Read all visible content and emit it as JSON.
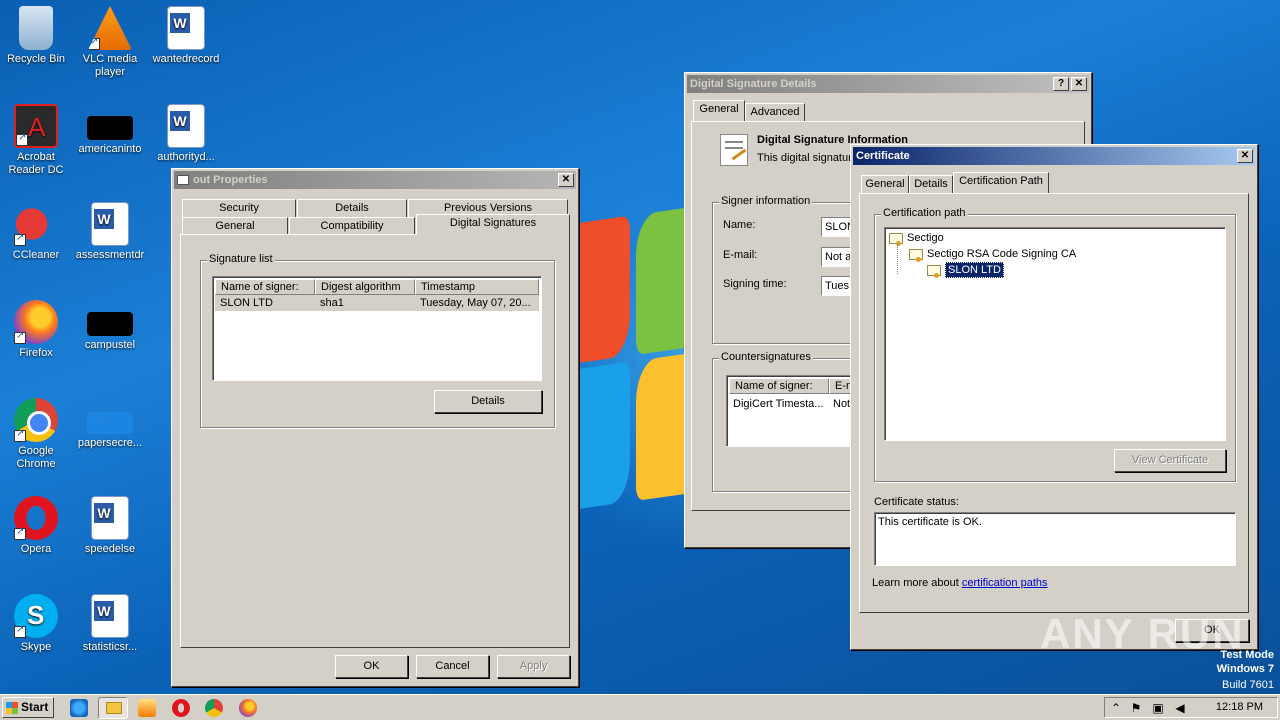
{
  "desktop": {
    "icons": [
      {
        "label": "Recycle Bin",
        "icon": "recycle-bin-icon"
      },
      {
        "label": "VLC media player",
        "icon": "vlc-icon"
      },
      {
        "label": "wantedrecord",
        "icon": "word-document-icon"
      },
      {
        "label": "Acrobat Reader DC",
        "icon": "acrobat-icon"
      },
      {
        "label": "americaninto",
        "icon": "black-file-icon"
      },
      {
        "label": "authorityd...",
        "icon": "word-document-icon"
      },
      {
        "label": "CCleaner",
        "icon": "ccleaner-icon"
      },
      {
        "label": "assessmentdr",
        "icon": "word-document-icon"
      },
      {
        "label": "Firefox",
        "icon": "firefox-icon"
      },
      {
        "label": "campustel",
        "icon": "black-file-icon"
      },
      {
        "label": "Google Chrome",
        "icon": "chrome-icon"
      },
      {
        "label": "papersecre...",
        "icon": "blank-file-icon"
      },
      {
        "label": "Opera",
        "icon": "opera-icon"
      },
      {
        "label": "speedelse",
        "icon": "word-document-icon"
      },
      {
        "label": "Skype",
        "icon": "skype-icon"
      },
      {
        "label": "statisticsr...",
        "icon": "word-document-icon"
      }
    ],
    "watermark": {
      "line1": "Test Mode",
      "line2": "Windows 7",
      "line3": "Build 7601"
    },
    "brand": "ANY RUN"
  },
  "properties": {
    "title": "out Properties",
    "tabs_row1": [
      "Security",
      "Details",
      "Previous Versions"
    ],
    "tabs_row2": [
      "General",
      "Compatibility",
      "Digital Signatures"
    ],
    "signature_list_label": "Signature list",
    "columns": [
      "Name of signer:",
      "Digest algorithm",
      "Timestamp"
    ],
    "rows": [
      {
        "signer": "SLON LTD",
        "digest": "sha1",
        "timestamp": "Tuesday, May 07, 20..."
      }
    ],
    "details_button": "Details",
    "ok": "OK",
    "cancel": "Cancel",
    "apply": "Apply"
  },
  "sigdetails": {
    "title": "Digital Signature Details",
    "help": "?",
    "close": "✕",
    "tabs": [
      "General",
      "Advanced"
    ],
    "info_heading": "Digital Signature Information",
    "info_text": "This digital signature",
    "signer_info_label": "Signer information",
    "name_label": "Name:",
    "name_value": "SLON",
    "email_label": "E-mail:",
    "email_value": "Not a",
    "signing_time_label": "Signing time:",
    "signing_time_value": "Tues",
    "countersig_label": "Countersignatures",
    "cs_columns": [
      "Name of signer:",
      "E-m"
    ],
    "cs_rows": [
      {
        "signer": "DigiCert Timesta...",
        "email": "Not"
      }
    ]
  },
  "certificate": {
    "title": "Certificate",
    "close": "✕",
    "tabs": [
      "General",
      "Details",
      "Certification Path"
    ],
    "path_label": "Certification path",
    "tree": [
      "Sectigo",
      "Sectigo RSA Code Signing CA",
      "SLON LTD"
    ],
    "view_button": "View Certificate",
    "status_label": "Certificate status:",
    "status_text": "This certificate is OK.",
    "learn_more_prefix": "Learn more about ",
    "learn_more_link": "certification paths",
    "ok": "OK"
  },
  "taskbar": {
    "start": "Start",
    "clock": "12:18 PM",
    "quick_launch": [
      "ie-icon",
      "explorer-icon",
      "media-player-icon",
      "opera-icon",
      "chrome-icon",
      "firefox-icon"
    ]
  }
}
